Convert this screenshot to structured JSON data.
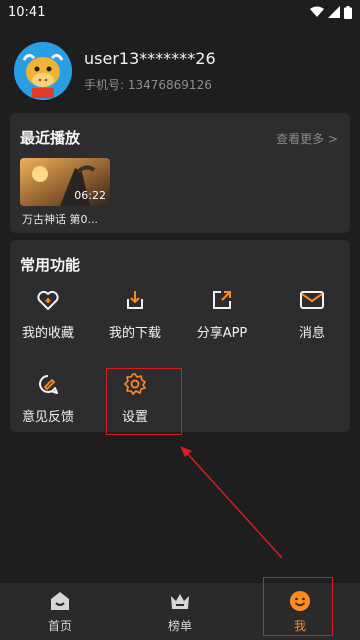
{
  "status_bar": {
    "time": "10:41"
  },
  "profile": {
    "username": "user13*******26",
    "phone": "手机号: 13476869126"
  },
  "recent": {
    "title": "最近播放",
    "see_more": "查看更多 >",
    "items": [
      {
        "duration": "06:22",
        "title": "万古神话 第0..."
      }
    ]
  },
  "functions": {
    "title": "常用功能",
    "items": [
      {
        "label": "我的收藏",
        "icon": "heart-icon"
      },
      {
        "label": "我的下载",
        "icon": "download-icon"
      },
      {
        "label": "分享APP",
        "icon": "share-icon"
      },
      {
        "label": "消息",
        "icon": "mail-icon"
      },
      {
        "label": "意见反馈",
        "icon": "feedback-icon"
      },
      {
        "label": "设置",
        "icon": "gear-icon"
      }
    ]
  },
  "bottom_nav": {
    "items": [
      {
        "label": "首页",
        "icon": "home-icon"
      },
      {
        "label": "榜单",
        "icon": "crown-icon"
      },
      {
        "label": "我",
        "icon": "smile-icon",
        "active": true
      }
    ]
  },
  "colors": {
    "accent": "#ff8a1f",
    "annotation": "#d42020",
    "background": "#1e1e1f",
    "card": "#2d2d2f"
  }
}
